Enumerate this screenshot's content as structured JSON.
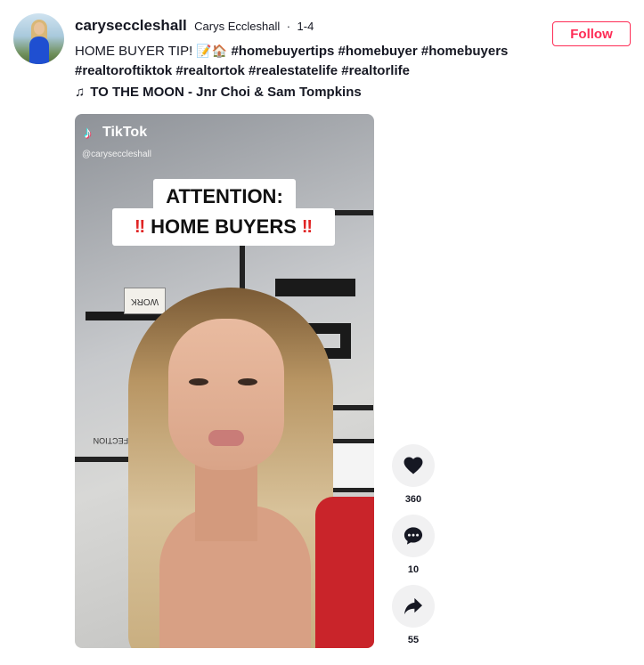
{
  "post": {
    "username": "caryseccleshall",
    "nickname": "Carys Eccleshall",
    "separator": "·",
    "date": "1-4",
    "follow_label": "Follow",
    "caption_text": "HOME BUYER TIP! ",
    "caption_emojis": "📝🏠",
    "hashtags_line1": " #homebuyertips #homebuyer #homebuyers",
    "hashtags_line2": "#realtoroftiktok #realtortok #realestatelife #realtorlife",
    "music_note": "♫",
    "music_title": "TO THE MOON - Jnr Choi & Sam Tompkins"
  },
  "video": {
    "logo_text": "TikTok",
    "logo_icon": "tiktok-note-icon",
    "handle": "@caryseccleshall",
    "banner_line1": "ATTENTION:",
    "banner_line2": "HOME BUYERS",
    "bang": "‼",
    "work_sign": "WORK",
    "shelf_label": "NOT PERFECTION"
  },
  "actions": {
    "likes": "360",
    "comments": "10",
    "shares": "55"
  }
}
